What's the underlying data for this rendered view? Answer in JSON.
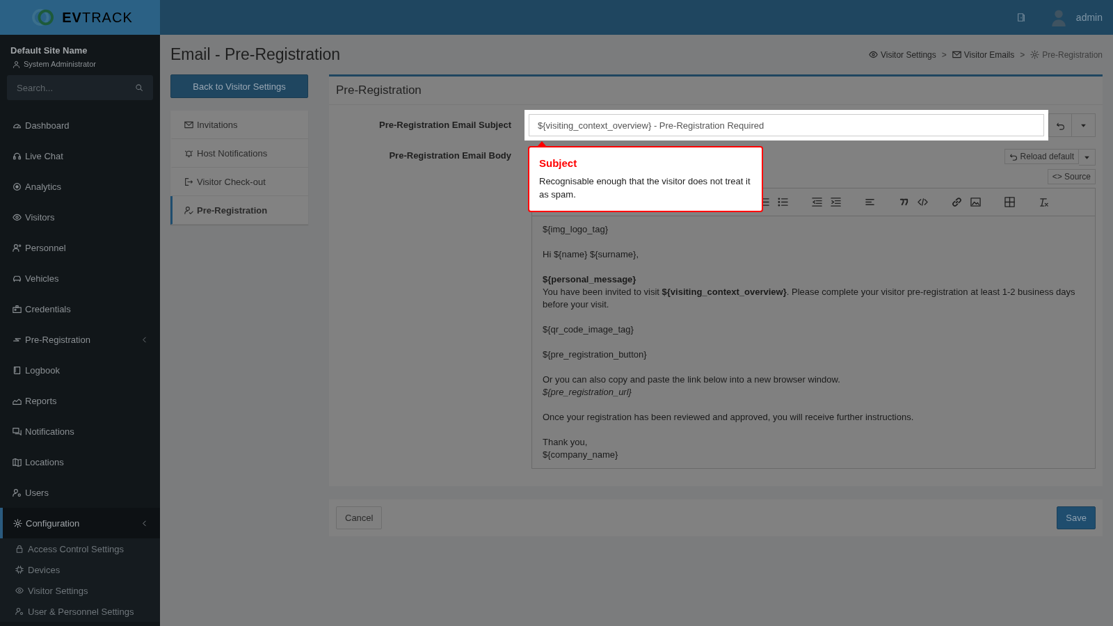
{
  "topbar": {
    "brand": "**EV**TRACK",
    "user": "admin"
  },
  "sidebar": {
    "site": "Default Site Name",
    "role": "System Administrator",
    "search": {
      "placeholder": "Search..."
    },
    "items": [
      {
        "label": "Dashboard",
        "selected": false,
        "has_submenu": false
      },
      {
        "label": "Live Chat",
        "selected": false,
        "has_submenu": false
      },
      {
        "label": "Analytics",
        "selected": false,
        "has_submenu": false
      },
      {
        "label": "Visitors",
        "selected": false,
        "has_submenu": false
      },
      {
        "label": "Personnel",
        "selected": false,
        "has_submenu": false
      },
      {
        "label": "Vehicles",
        "selected": false,
        "has_submenu": false
      },
      {
        "label": "Credentials",
        "selected": false,
        "has_submenu": false
      },
      {
        "label": "Pre-Registration",
        "selected": false,
        "has_submenu": true
      },
      {
        "label": "Logbook",
        "selected": false,
        "has_submenu": false
      },
      {
        "label": "Reports",
        "selected": false,
        "has_submenu": false
      },
      {
        "label": "Notifications",
        "selected": false,
        "has_submenu": false
      },
      {
        "label": "Locations",
        "selected": false,
        "has_submenu": false
      },
      {
        "label": "Users",
        "selected": false,
        "has_submenu": false
      },
      {
        "label": "Configuration",
        "selected": true,
        "has_submenu": true,
        "children": [
          {
            "label": "Access Control Settings"
          },
          {
            "label": "Devices"
          },
          {
            "label": "Visitor Settings"
          },
          {
            "label": "User & Personnel Settings"
          }
        ]
      }
    ]
  },
  "page": {
    "title": "Email - Pre-Registration",
    "breadcrumb": [
      {
        "label": "Visitor Settings",
        "current": false
      },
      {
        "label": "Visitor Emails",
        "current": false
      },
      {
        "label": "Pre-Registration",
        "current": true
      }
    ],
    "separator": ">",
    "back_button": "Back to Visitor Settings",
    "tabs": [
      {
        "label": "Invitations",
        "selected": false
      },
      {
        "label": "Host Notifications",
        "selected": false
      },
      {
        "label": "Visitor Check-out",
        "selected": false
      },
      {
        "label": "Pre-Registration",
        "selected": true
      }
    ]
  },
  "panel": {
    "title": "Pre-Registration",
    "subject": {
      "label": "Pre-Registration Email Subject",
      "value": "${visiting_context_overview} - Pre-Registration Required"
    },
    "body": {
      "label": "Pre-Registration Email Body",
      "reload_button": "Reload default",
      "source_button": "<> Source",
      "paragraphs": [
        [
          {
            "text": "${img_logo_tag}",
            "kind": "plain"
          }
        ],
        [
          {
            "text": "Hi ${name} ${surname},",
            "kind": "plain"
          }
        ],
        [
          {
            "text": "${personal_message}",
            "kind": "bold"
          },
          {
            "text": "You have been invited to visit **${visiting_context_overview}**. Please complete your visitor pre-registration at least 1-2 business days before your visit.",
            "kind": "plain"
          }
        ],
        [
          {
            "text": "${qr_code_image_tag}",
            "kind": "plain"
          }
        ],
        [
          {
            "text": "${pre_registration_button}",
            "kind": "plain"
          }
        ],
        [
          {
            "text": "Or you can also copy and paste the link below into a new browser window.",
            "kind": "plain"
          },
          {
            "text": "${pre_registration_url}",
            "kind": "italic"
          }
        ],
        [
          {
            "text": "Once your registration has been reviewed and approved, you will receive further instructions.",
            "kind": "plain"
          }
        ],
        [
          {
            "text": "Thank you,",
            "kind": "plain"
          },
          {
            "text": "${company_name}",
            "kind": "plain"
          }
        ]
      ]
    },
    "footer": {
      "cancel": "Cancel",
      "save": "Save"
    }
  },
  "tooltip": {
    "title": "Subject",
    "text": "Recognisable enough that the visitor does not treat it as spam."
  }
}
